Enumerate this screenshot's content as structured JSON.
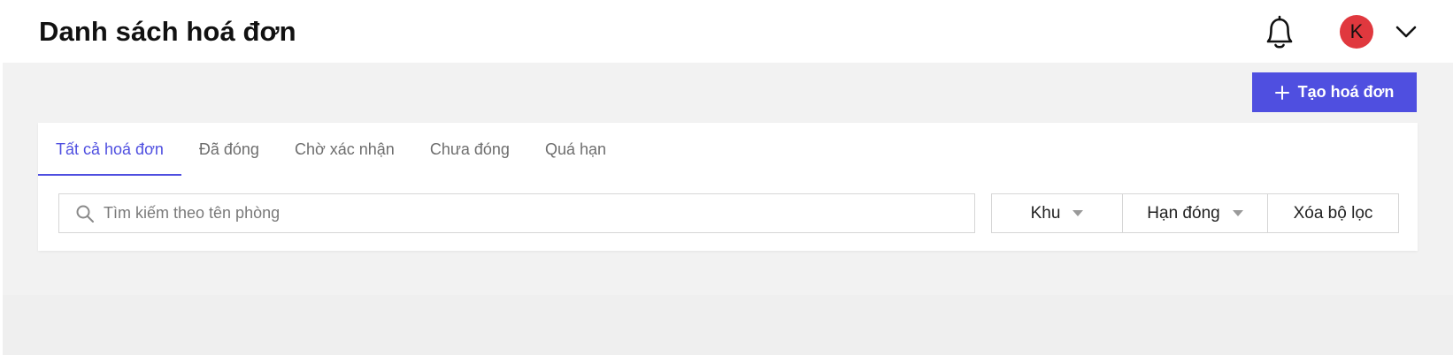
{
  "header": {
    "title": "Danh sách hoá đơn",
    "avatar_initial": "K",
    "avatar_color": "#e0383e"
  },
  "actions": {
    "create_label": "Tạo hoá đơn",
    "accent_color": "#4f4fe0"
  },
  "tabs": [
    {
      "label": "Tất cả hoá đơn",
      "active": true
    },
    {
      "label": "Đã đóng",
      "active": false
    },
    {
      "label": "Chờ xác nhận",
      "active": false
    },
    {
      "label": "Chưa đóng",
      "active": false
    },
    {
      "label": "Quá hạn",
      "active": false
    }
  ],
  "search": {
    "placeholder": "Tìm kiếm theo tên phòng",
    "value": ""
  },
  "filters": {
    "area_label": "Khu",
    "due_label": "Hạn đóng",
    "clear_label": "Xóa bộ lọc"
  },
  "icons": {
    "notification": "bell-icon",
    "account_menu": "chevron-down-icon",
    "create": "plus-icon",
    "search": "search-icon",
    "dropdown": "caret-down-icon"
  }
}
